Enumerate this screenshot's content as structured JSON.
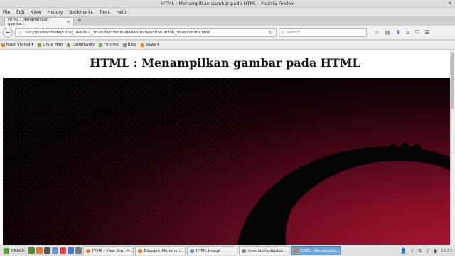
{
  "window": {
    "title": "HTML : Menampilkan gambar pada HTML - Mozilla Firefox"
  },
  "menu": [
    "File",
    "Edit",
    "View",
    "History",
    "Bookmarks",
    "Tools",
    "Help"
  ],
  "tab": {
    "label": "HTML : Menampilkan gamba...",
    "close": "×",
    "new_tab": "+"
  },
  "nav": {
    "url": "file:///media/shodiq/Local_Disk/BLC_TELKOM/PEMBELAJARAN/BelajarHTML/HTML_Image/index.html",
    "search_placeholder": "Search"
  },
  "bookmarks": [
    {
      "label": "Most Visited ▾"
    },
    {
      "label": "Linux Mint"
    },
    {
      "label": "Community"
    },
    {
      "label": "Forums"
    },
    {
      "label": "Blog"
    },
    {
      "label": "News ▾"
    }
  ],
  "page": {
    "heading": "HTML : Menampilkan gambar pada HTML"
  },
  "taskbar": {
    "menu_label": "CRACK",
    "tasks": [
      {
        "label": "[VYM - View Your M...",
        "active": false
      },
      {
        "label": "Blogger: Muhamm...",
        "active": false
      },
      {
        "label": "HTML Image",
        "active": false
      },
      {
        "label": "/media/shodiq/Loc...",
        "active": false
      },
      {
        "label": "HTML : Menampilk...",
        "active": true
      }
    ],
    "clock": "12:03"
  }
}
